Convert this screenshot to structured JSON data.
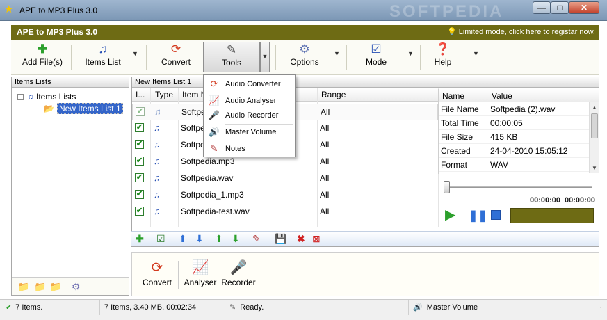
{
  "window": {
    "title": "APE to MP3 Plus 3.0",
    "watermark": "SOFTPEDIA",
    "min": "—",
    "max": "□",
    "close": "✕"
  },
  "appbar": {
    "name": "APE to MP3 Plus 3.0",
    "notice": "Limited mode, click here to registar now."
  },
  "toolbar": {
    "add_files": "Add File(s)",
    "items_list": "Items List",
    "convert": "Convert",
    "tools": "Tools",
    "options": "Options",
    "mode": "Mode",
    "help": "Help"
  },
  "left_panel": {
    "header": "Items Lists",
    "root": "Items Lists",
    "child": "New Items List 1"
  },
  "list_panel": {
    "header": "New Items List 1",
    "columns": {
      "check": "I...",
      "type": "Type",
      "name": "Item N",
      "range": "Range"
    },
    "rows": [
      {
        "name": "Softpe",
        "range": "All",
        "checked": "✔"
      },
      {
        "name": "Softpe",
        "range": "All",
        "checked": "✔"
      },
      {
        "name": "Softpe",
        "range": "All",
        "checked": "✔"
      },
      {
        "name": "Softpedia.mp3",
        "range": "All",
        "checked": "✔"
      },
      {
        "name": "Softpedia.wav",
        "range": "All",
        "checked": "✔"
      },
      {
        "name": "Softpedia_1.mp3",
        "range": "All",
        "checked": "✔"
      },
      {
        "name": "Softpedia-test.wav",
        "range": "All",
        "checked": "✔"
      }
    ]
  },
  "properties": {
    "col_name": "Name",
    "col_value": "Value",
    "rows": [
      {
        "k": "File Name",
        "v": "Softpedia (2).wav"
      },
      {
        "k": "Total Time",
        "v": "00:00:05"
      },
      {
        "k": "File Size",
        "v": "415 KB"
      },
      {
        "k": "Created",
        "v": "24-04-2010 15:05:12"
      },
      {
        "k": "Format",
        "v": "WAV"
      }
    ]
  },
  "player": {
    "position": "00:00:00",
    "duration": "00:00:00",
    "progress": 0
  },
  "bottom": {
    "convert": "Convert",
    "analyser": "Analyser",
    "recorder": "Recorder"
  },
  "status": {
    "items": "7 Items.",
    "summary": "7 Items, 3.40 MB, 00:02:34",
    "state": "Ready.",
    "volume": "Master Volume"
  },
  "tools_menu": {
    "items": [
      "Audio Converter",
      "Audio Analyser",
      "Audio Recorder",
      "Master Volume",
      "Notes"
    ]
  },
  "colors": {
    "accent": "#6e6b14",
    "selection": "#3465c9",
    "check": "#1f8a1f"
  }
}
